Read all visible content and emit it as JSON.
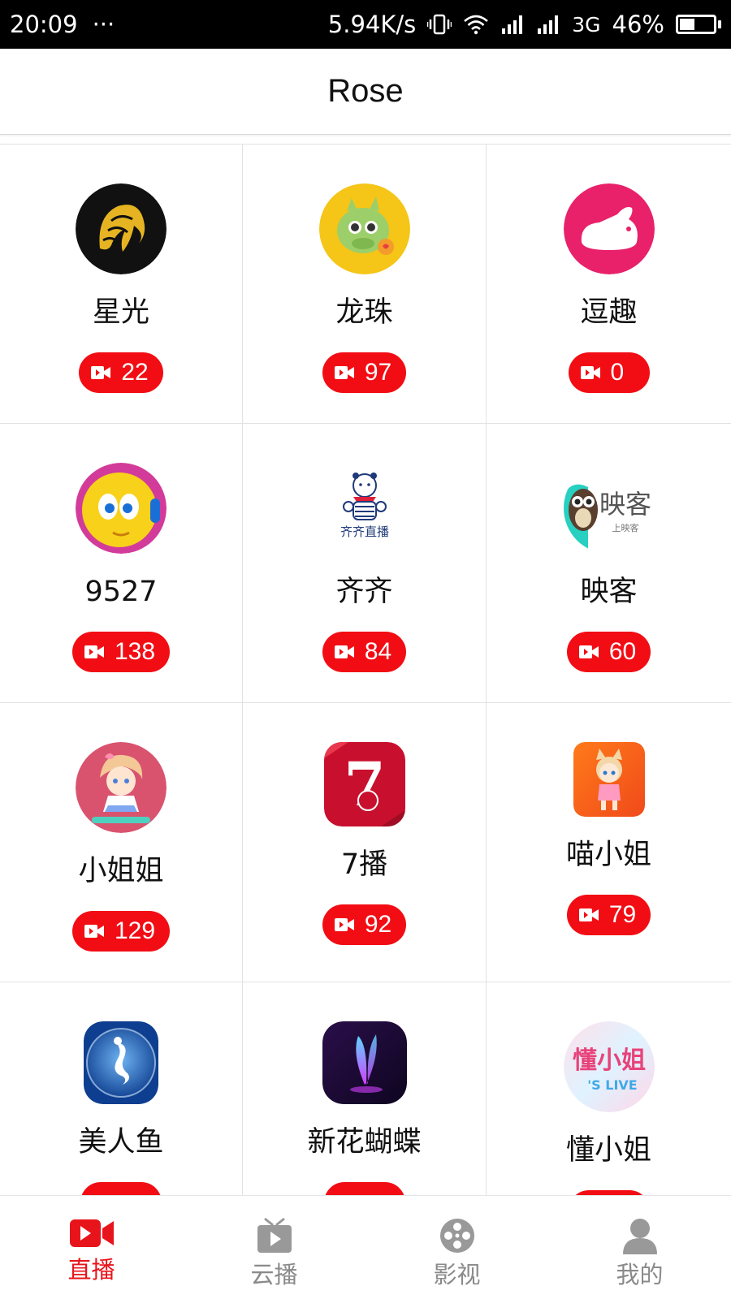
{
  "status_bar": {
    "time": "20:09",
    "more": "···",
    "speed": "5.94K/s",
    "network": "3G",
    "battery": "46%",
    "battery_level": 0.46
  },
  "header": {
    "title": "Rose"
  },
  "platforms": [
    {
      "name": "星光",
      "count": "22",
      "icon": "starlight-logo"
    },
    {
      "name": "龙珠",
      "count": "97",
      "icon": "dragon-logo"
    },
    {
      "name": "逗趣",
      "count": "0",
      "icon": "rabbit-logo"
    },
    {
      "name": "9527",
      "count": "138",
      "icon": "cartoon-face-logo"
    },
    {
      "name": "齐齐",
      "count": "84",
      "icon": "bear-logo"
    },
    {
      "name": "映客",
      "count": "60",
      "icon": "owl-logo"
    },
    {
      "name": "小姐姐",
      "count": "129",
      "icon": "anime-girl-logo"
    },
    {
      "name": "7播",
      "count": "92",
      "icon": "seven-logo"
    },
    {
      "name": "喵小姐",
      "count": "79",
      "icon": "cat-girl-logo"
    },
    {
      "name": "美人鱼",
      "count": "",
      "icon": "mermaid-logo"
    },
    {
      "name": "新花蝴蝶",
      "count": "",
      "icon": "butterfly-logo"
    },
    {
      "name": "懂小姐",
      "count": "",
      "icon": "dong-xiaojie-logo"
    }
  ],
  "logo_text": {
    "qiqi_caption": "齐齐直播",
    "yingke_text": "映客",
    "yingke_sub": "上映客",
    "seven_text": "7",
    "dong_text": "懂小姐",
    "dong_sub": "'S LIVE"
  },
  "bottom_nav": [
    {
      "label": "直播",
      "icon": "video-camera-icon",
      "active": true
    },
    {
      "label": "云播",
      "icon": "tv-play-icon",
      "active": false
    },
    {
      "label": "影视",
      "icon": "film-reel-icon",
      "active": false
    },
    {
      "label": "我的",
      "icon": "person-icon",
      "active": false
    }
  ],
  "colors": {
    "accent": "#f20d14",
    "nav_active": "#e8141b",
    "nav_inactive": "#8a8a8a"
  }
}
